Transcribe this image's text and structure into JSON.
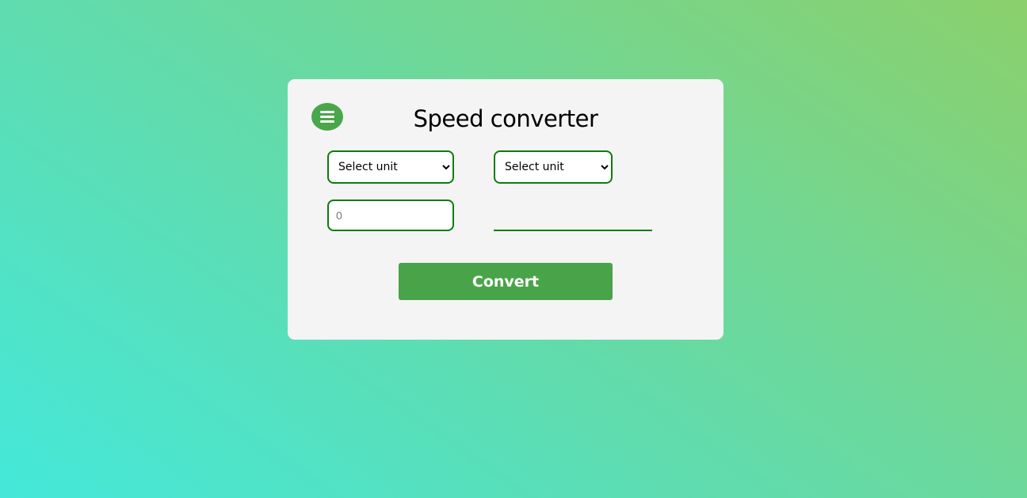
{
  "title": "Speed converter",
  "menu_icon": "hamburger-menu-icon",
  "from_unit": {
    "selected": "Select unit"
  },
  "to_unit": {
    "selected": "Select unit"
  },
  "input": {
    "value": "",
    "placeholder": "0"
  },
  "output": {
    "value": ""
  },
  "convert_label": "Convert",
  "colors": {
    "accent": "#49a449",
    "border": "#0a7d0a",
    "card": "#f4f4f4",
    "bg_start": "#44e8da",
    "bg_end": "#8bd06c"
  }
}
